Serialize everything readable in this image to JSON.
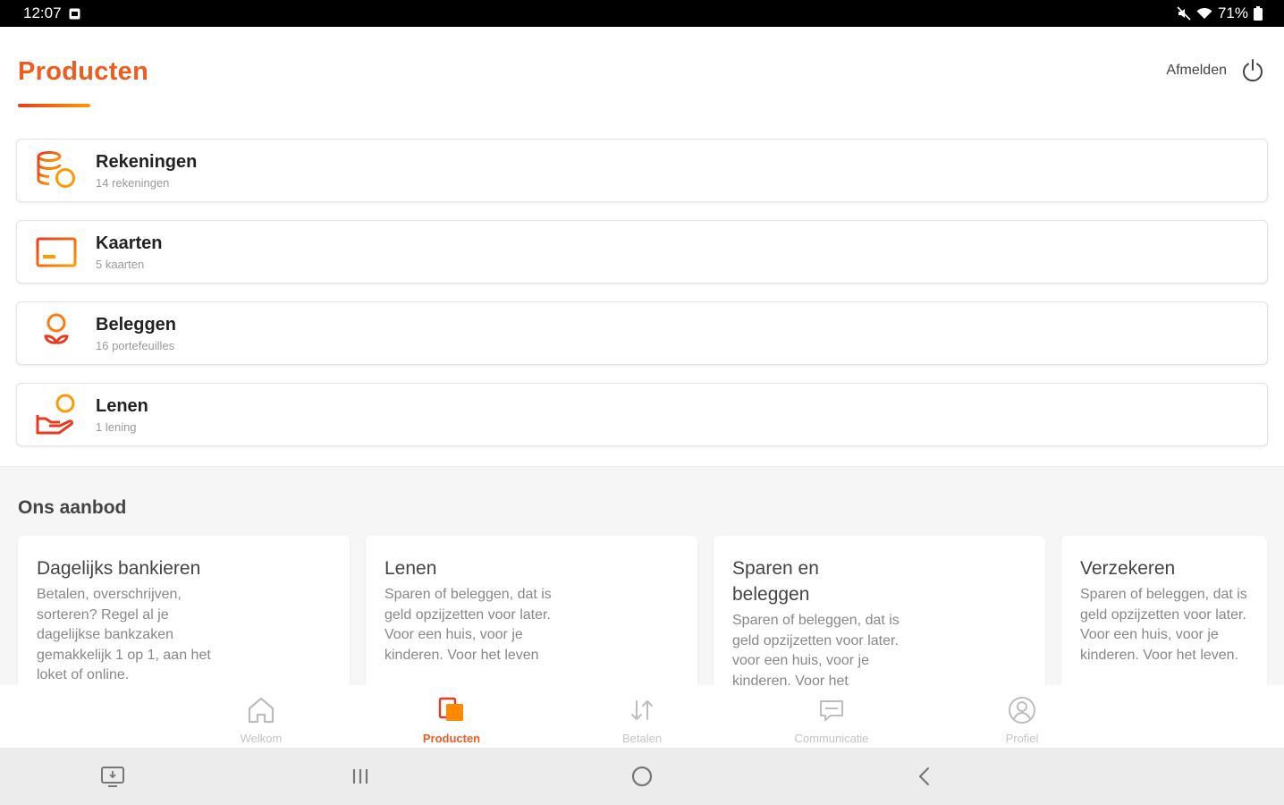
{
  "status_bar": {
    "time": "12:07",
    "battery": "71%"
  },
  "header": {
    "title": "Producten",
    "logout_label": "Afmelden"
  },
  "products": [
    {
      "name": "Rekeningen",
      "count": "14 rekeningen",
      "icon": "coins-icon"
    },
    {
      "name": "Kaarten",
      "count": "5 kaarten",
      "icon": "card-icon"
    },
    {
      "name": "Beleggen",
      "count": "16 portefeuilles",
      "icon": "plant-icon"
    },
    {
      "name": "Lenen",
      "count": "1 lening",
      "icon": "loan-hand-icon"
    }
  ],
  "offer": {
    "title": "Ons aanbod",
    "cards": [
      {
        "title": "Dagelijks bankieren",
        "text": "Betalen, overschrijven, sorteren? Regel al je dagelijkse bankzaken gemakkelijk 1 op 1, aan het loket of online."
      },
      {
        "title": "Lenen",
        "text": "Sparen of beleggen, dat is geld opzijzetten voor later. Voor een huis, voor je kinderen. Voor het leven"
      },
      {
        "title": "Sparen en beleggen",
        "text": "Sparen of beleggen, dat is geld opzijzetten voor later. voor een huis, voor je kinderen. Voor het"
      },
      {
        "title": "Verzekeren",
        "text": "Sparen of beleggen, dat is geld opzijzetten voor later. Voor een huis, voor je kinderen. Voor het leven."
      }
    ]
  },
  "bottom_nav": [
    {
      "label": "Welkom",
      "icon": "home-icon"
    },
    {
      "label": "Producten",
      "icon": "products-icon",
      "active": true
    },
    {
      "label": "Betalen",
      "icon": "transfer-arrows-icon"
    },
    {
      "label": "Communicatie",
      "icon": "message-icon"
    },
    {
      "label": "Profiel",
      "icon": "profile-icon"
    }
  ],
  "colors": {
    "accent": "#ee5d1f",
    "accent_red": "#e63b22",
    "accent_orange": "#ff9a00"
  }
}
